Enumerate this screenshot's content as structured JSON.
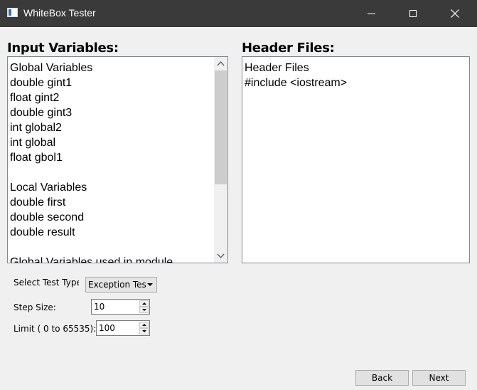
{
  "window": {
    "title": "WhiteBox Tester",
    "controls": {
      "minimize": "minimize-icon",
      "maximize": "maximize-icon",
      "close": "close-icon"
    }
  },
  "input_variables": {
    "label": "Input Variables:",
    "lines": [
      "Global Variables",
      "double gint1",
      "float gint2",
      "double gint3",
      "int global2",
      "int global",
      "float gbol1",
      "",
      "Local Variables",
      "double first",
      "double second",
      "double result",
      "",
      "Global Variables used in module"
    ]
  },
  "header_files": {
    "label": "Header Files:",
    "lines": [
      "Header Files",
      "#include <iostream>"
    ]
  },
  "form": {
    "test_type_label": "Select Test Type",
    "test_type_value": "Exception Test",
    "step_size_label": "Step Size:",
    "step_size_value": "10",
    "limit_label": "Limit ( 0 to 65535):",
    "limit_value": "100"
  },
  "buttons": {
    "back": "Back",
    "next": "Next"
  }
}
